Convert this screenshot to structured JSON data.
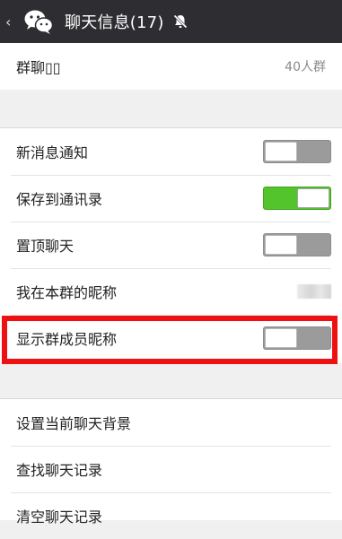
{
  "topbar": {
    "back_icon": "chevron-left-icon",
    "app_icon": "wechat-icon",
    "title": "聊天信息(17)",
    "mute_icon": "bell-muted-icon"
  },
  "group": {
    "name_label": "群聊▯▯",
    "name_value": "40人群"
  },
  "settings": [
    {
      "label": "新消息通知",
      "toggle": "off"
    },
    {
      "label": "保存到通讯录",
      "toggle": "on"
    },
    {
      "label": "置顶聊天",
      "toggle": "off"
    },
    {
      "label": "我在本群的昵称",
      "value_redacted": true
    },
    {
      "label": "显示群成员昵称",
      "toggle": "off",
      "highlighted": true
    }
  ],
  "chat_actions": [
    {
      "label": "设置当前聊天背景"
    },
    {
      "label": "查找聊天记录"
    },
    {
      "label": "清空聊天记录"
    }
  ],
  "colors": {
    "topbar": "#2e2e32",
    "toggle_on": "#54c42c",
    "toggle_off": "#9a9b9a",
    "highlight": "#ee1111"
  }
}
